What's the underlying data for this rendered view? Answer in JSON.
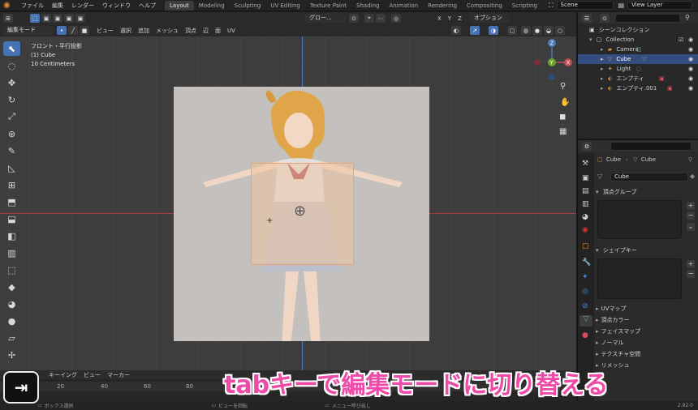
{
  "menubar": {
    "items": [
      "ファイル",
      "編集",
      "レンダー",
      "ウィンドウ",
      "ヘルプ"
    ],
    "workspaces": [
      "Layout",
      "Modeling",
      "Sculpting",
      "UV Editing",
      "Texture Paint",
      "Shading",
      "Animation",
      "Rendering",
      "Compositing",
      "Scripting"
    ],
    "scene": "Scene",
    "view_layer": "View Layer"
  },
  "header": {
    "transform_orientation": "グロー...",
    "options": "オプション"
  },
  "header2": {
    "mode": "編集モード",
    "menus": [
      "ビュー",
      "選択",
      "追加",
      "メッシュ",
      "頂点",
      "辺",
      "面",
      "UV"
    ]
  },
  "viewport": {
    "view_name": "フロント・平行投影",
    "object_info": "(1) Cube",
    "scale": "10 Centimeters",
    "gizmo": {
      "x": "X",
      "y": "Y",
      "z": "Z"
    },
    "colors": {
      "bg": "#3d3d3d",
      "reference_image": "#c4c0bd",
      "selection_box": "#e8a46a",
      "x_axis": "#a8383f",
      "z_axis": "#4a78b8"
    }
  },
  "timeline": {
    "menus": [
      "キーイング",
      "ビュー",
      "マーカー"
    ],
    "ticks": [
      "20",
      "40",
      "60",
      "80"
    ]
  },
  "status": {
    "left": "ボックス選択",
    "middle": "ビューを回転",
    "right": "メニュー呼び出し",
    "version": "2.92.0"
  },
  "outliner": {
    "scene_collection": "シーンコレクション",
    "collection": "Collection",
    "items": [
      {
        "name": "Camera",
        "selected": false
      },
      {
        "name": "Cube",
        "selected": true
      },
      {
        "name": "Light",
        "selected": false
      },
      {
        "name": "エンプティ",
        "selected": false
      },
      {
        "name": "エンプティ.001",
        "selected": false
      }
    ]
  },
  "properties": {
    "breadcrumb_object": "Cube",
    "breadcrumb_data": "Cube",
    "data_name": "Cube",
    "vertex_groups": "頂点グループ",
    "shape_keys": "シェイプキー",
    "collapsed_panels": [
      "UVマップ",
      "頂点カラー",
      "フェイスマップ",
      "ノーマル",
      "テクスチャ空間",
      "リメッシュ"
    ]
  },
  "caption": {
    "text": "tabキーで編集モードに切り替える",
    "key_icon": "tab-key-icon",
    "color": "#ee4aa8"
  }
}
